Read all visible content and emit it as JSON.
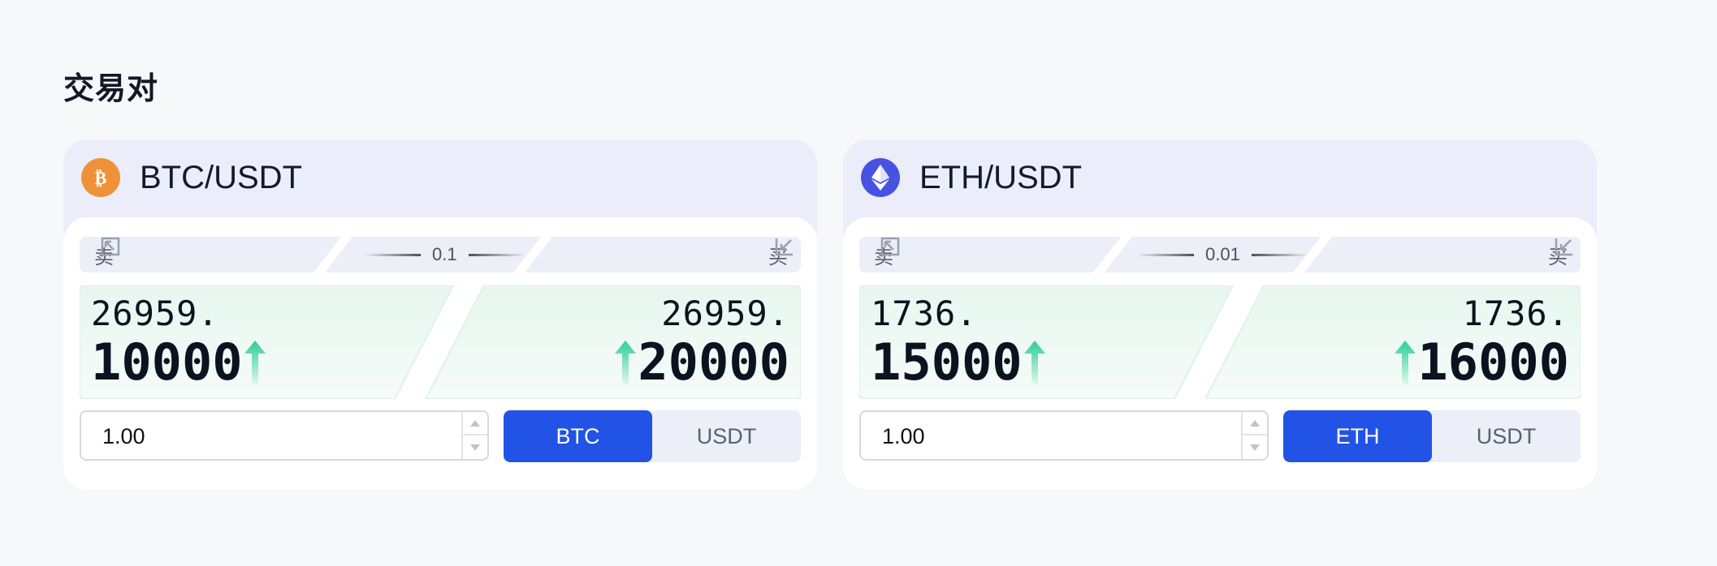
{
  "page": {
    "title": "交易对"
  },
  "pairs": [
    {
      "name": "BTC/USDT",
      "icon": "bitcoin-icon",
      "icon_color": "#f0913a",
      "sell_label": "卖",
      "buy_label": "买",
      "spread": "0.1",
      "sell_price_int": "26959.",
      "sell_price_dec": "10000",
      "buy_price_int": "26959.",
      "buy_price_dec": "20000",
      "amount": "1.00",
      "units": [
        "BTC",
        "USDT"
      ],
      "active_unit": "BTC"
    },
    {
      "name": "ETH/USDT",
      "icon": "ethereum-icon",
      "icon_color": "#4753e0",
      "sell_label": "卖",
      "buy_label": "买",
      "spread": "0.01",
      "sell_price_int": "1736.",
      "sell_price_dec": "15000",
      "buy_price_int": "1736.",
      "buy_price_dec": "16000",
      "amount": "1.00",
      "units": [
        "ETH",
        "USDT"
      ],
      "active_unit": "ETH"
    }
  ],
  "colors": {
    "accent": "#2153e6",
    "up_arrow": "#2ecf93",
    "card_bg": "#ecedfa",
    "price_bg": "#e9f8f1"
  }
}
